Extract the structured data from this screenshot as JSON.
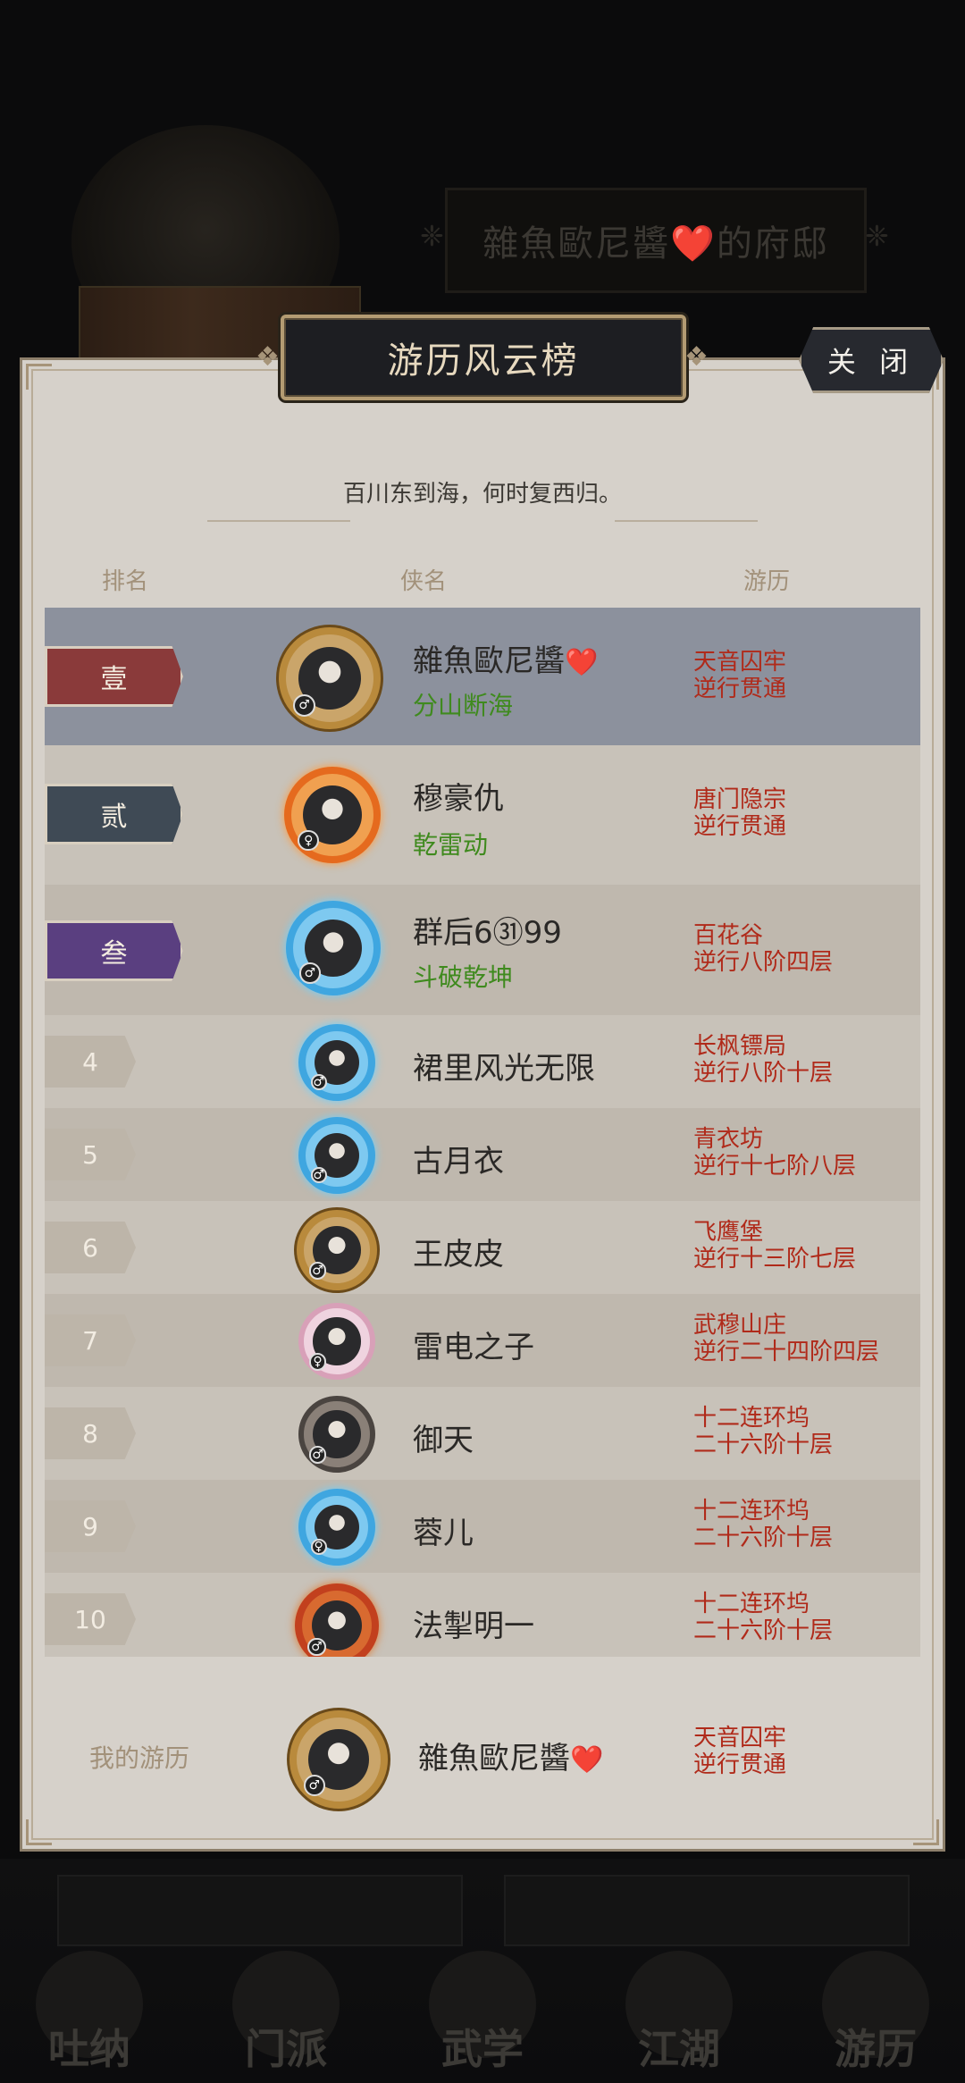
{
  "background": {
    "banner_text": "雜魚歐尼醬❤️的府邸",
    "bottom_tabs": [
      "吐纳",
      "门派",
      "武学",
      "江湖",
      "游历"
    ]
  },
  "dialog": {
    "title": "游历风云榜",
    "close_label": "关 闭",
    "subtitle": "百川东到海，何时复西归。",
    "columns": {
      "rank": "排名",
      "name": "侠名",
      "progress": "游历"
    }
  },
  "rankings": [
    {
      "rank": "壹",
      "name": "雜魚歐尼醬",
      "heart": "❤️",
      "title": "分山断海",
      "gender": "♂",
      "location": "天音囚牢",
      "progress": "逆行贯通"
    },
    {
      "rank": "贰",
      "name": "穆豪仇",
      "heart": "",
      "title": "乾雷动",
      "gender": "♀",
      "location": "唐门隐宗",
      "progress": "逆行贯通"
    },
    {
      "rank": "叁",
      "name": "群后6㉛99",
      "heart": "",
      "title": "斗破乾坤",
      "gender": "♂",
      "location": "百花谷",
      "progress": "逆行八阶四层"
    },
    {
      "rank": "4",
      "name": "裙里风光无限",
      "heart": "",
      "title": "",
      "gender": "♂",
      "location": "长枫镖局",
      "progress": "逆行八阶十层"
    },
    {
      "rank": "5",
      "name": "古月衣",
      "heart": "",
      "title": "",
      "gender": "♂",
      "location": "青衣坊",
      "progress": "逆行十七阶八层"
    },
    {
      "rank": "6",
      "name": "王皮皮",
      "heart": "",
      "title": "",
      "gender": "♂",
      "location": "飞鹰堡",
      "progress": "逆行十三阶七层"
    },
    {
      "rank": "7",
      "name": "雷电之子",
      "heart": "",
      "title": "",
      "gender": "♀",
      "location": "武穆山庄",
      "progress": "逆行二十四阶四层"
    },
    {
      "rank": "8",
      "name": "御天",
      "heart": "",
      "title": "",
      "gender": "♂",
      "location": "十二连环坞",
      "progress": "二十六阶十层"
    },
    {
      "rank": "9",
      "name": "蓉儿",
      "heart": "",
      "title": "",
      "gender": "♀",
      "location": "十二连环坞",
      "progress": "二十六阶十层"
    },
    {
      "rank": "10",
      "name": "法掣明一",
      "heart": "",
      "title": "",
      "gender": "♂",
      "location": "十二连环坞",
      "progress": "二十六阶十层"
    }
  ],
  "my_record": {
    "label": "我的游历",
    "name": "雜魚歐尼醬",
    "heart": "❤️",
    "gender": "♂",
    "location": "天音囚牢",
    "progress": "逆行贯通"
  },
  "colors": {
    "rank1_tag": "#8a3a3a",
    "rank2_tag": "#3f4a55",
    "rank3_tag": "#5a3f80",
    "title_green": "#3f8a1e",
    "location_red": "#b02a1a"
  }
}
